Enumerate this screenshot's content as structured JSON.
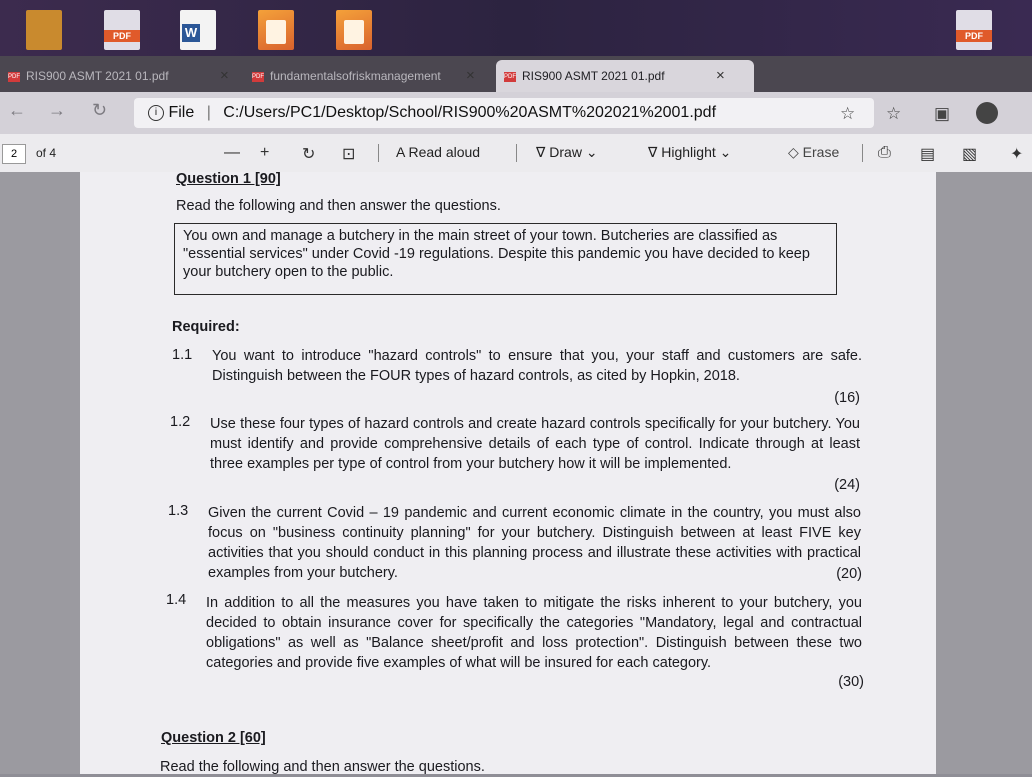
{
  "taskbar": {
    "icons": [
      {
        "name": "file-icon"
      },
      {
        "name": "pdf-icon",
        "label": "PDF"
      },
      {
        "name": "word-icon",
        "label": "W"
      },
      {
        "name": "app-icon"
      },
      {
        "name": "app-icon"
      },
      {
        "name": "pdf-icon",
        "label": "PDF"
      }
    ]
  },
  "tabs": [
    {
      "title": "RIS900 ASMT 2021 01.pdf",
      "fav": "PDF"
    },
    {
      "title": "fundamentalsofriskmanagement",
      "fav": "PDF"
    },
    {
      "title": "RIS900 ASMT 2021 01.pdf",
      "fav": "PDF",
      "active": true
    }
  ],
  "address": {
    "label": "File",
    "url": "C:/Users/PC1/Desktop/School/RIS900%20ASMT%202021%2001.pdf"
  },
  "pdf_toolbar": {
    "page": "2",
    "of": "of 4",
    "read_aloud": "Read aloud",
    "draw": "Draw",
    "highlight": "Highlight",
    "erase": "Erase"
  },
  "document": {
    "q1_title": "Question 1 [90]",
    "q1_intro": "Read the following and then answer the questions.",
    "scenario": "You own and manage a butchery in the main street of your town. Butcheries are classified as \"essential services\" under Covid -19 regulations. Despite this pandemic you have decided to keep your butchery open to the public.",
    "required": "Required:",
    "questions": [
      {
        "num": "1.1",
        "text": "You want to introduce \"hazard controls\" to ensure that you, your staff and customers are safe. Distinguish between the FOUR types of hazard controls, as cited by Hopkin, 2018.",
        "marks": "(16)"
      },
      {
        "num": "1.2",
        "text": "Use these four types of hazard controls and create hazard controls specifically for your butchery. You must identify and provide comprehensive details of each type of control. Indicate through at least three examples per type of control from your butchery how it will be implemented.",
        "marks": "(24)"
      },
      {
        "num": "1.3",
        "text": "Given the current Covid – 19 pandemic and current economic climate in the country, you must also focus on \"business continuity planning\" for your butchery. Distinguish between at least FIVE key activities that you should conduct in this planning process and illustrate these activities with practical examples from your butchery.",
        "marks": "(20)"
      },
      {
        "num": "1.4",
        "text": "In addition to all the measures you have taken to mitigate the risks inherent to your butchery, you decided to obtain insurance cover for specifically the categories \"Mandatory, legal and contractual obligations\" as well as \"Balance sheet/profit and loss protection\". Distinguish between these two categories and provide five examples of what will be insured for each category.",
        "marks": "(30)"
      }
    ],
    "q2_title": "Question 2 [60]",
    "q2_intro": "Read the following and then answer the questions."
  }
}
